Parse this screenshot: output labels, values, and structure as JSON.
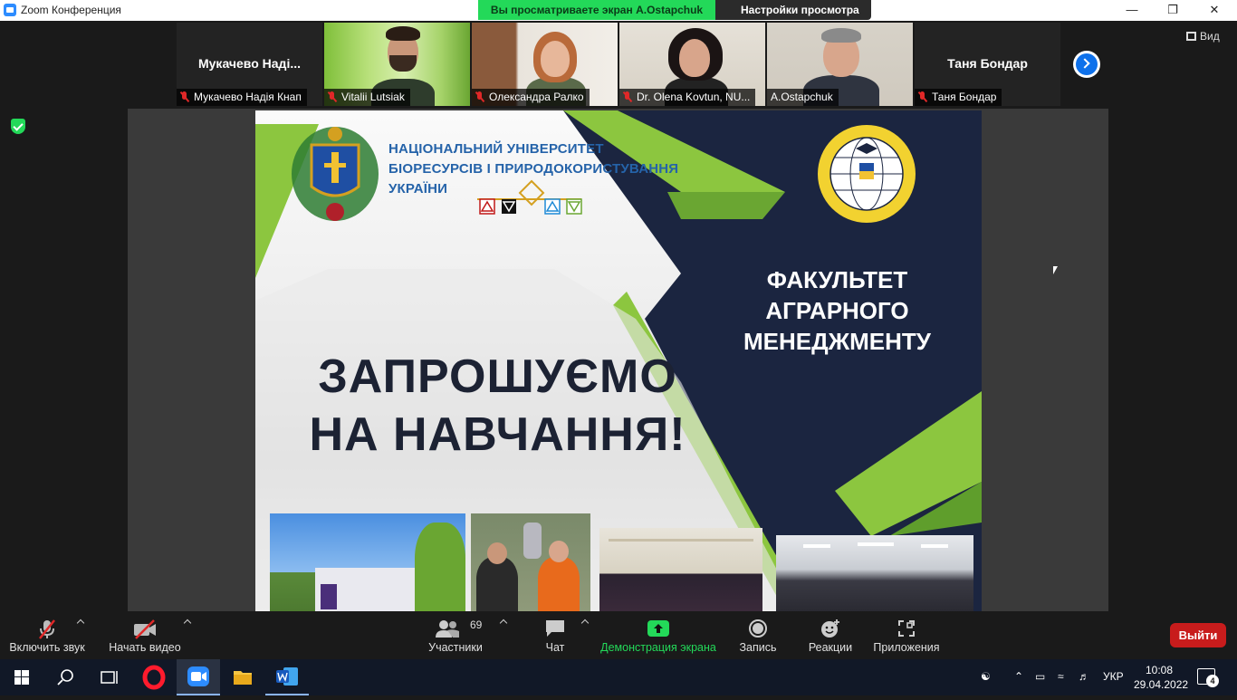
{
  "window": {
    "title": "Zoom Конференция",
    "minimize": "—",
    "maximize": "❐",
    "close": "✕"
  },
  "share": {
    "banner": "Вы просматриваете экран A.Ostapchuk",
    "view_settings": "Настройки просмотра"
  },
  "gallery": {
    "tiles": [
      {
        "big_name": "Мукачево  Наді...",
        "label": "Мукачево Надія Кнап",
        "muted": true,
        "video": false
      },
      {
        "label": "Vitalii Lutsiak",
        "muted": true,
        "video": true
      },
      {
        "label": "Олександра Ралко",
        "muted": true,
        "video": true
      },
      {
        "label": "Dr. Olena Kovtun, NU...",
        "muted": true,
        "video": true
      },
      {
        "label": "A.Ostapchuk",
        "muted": false,
        "video": true,
        "active": true
      },
      {
        "big_name": "Таня Бондар",
        "label": "Таня Бондар",
        "muted": true,
        "video": false
      }
    ],
    "view_label": "Вид"
  },
  "slide": {
    "university": [
      "НАЦІОНАЛЬНИЙ УНІВЕРСИТЕТ",
      "БІОРЕСУРСІВ І ПРИРОДОКОРИСТУВАННЯ",
      "УКРАЇНИ"
    ],
    "faculty": [
      "ФАКУЛЬТЕТ",
      "АГРАРНОГО",
      "МЕНЕДЖМЕНТУ"
    ],
    "invite": [
      "ЗАПРОШУЄМО",
      "НА НАВЧАННЯ!"
    ],
    "logo_text": "НУБіП",
    "seal_text": "ФАКУЛЬТЕТ АГРАРНОГО МЕНЕДЖМЕНТУ НУБіП УКРАЇНИ"
  },
  "toolbar": {
    "audio": "Включить звук",
    "video": "Начать видео",
    "participants": "Участники",
    "participants_count": "69",
    "chat": "Чат",
    "share": "Демонстрация экрана",
    "record": "Запись",
    "reactions": "Реакции",
    "apps": "Приложения",
    "leave": "Выйти"
  },
  "taskbar": {
    "language": "УКР",
    "time": "10:08",
    "date": "29.04.2022",
    "notifications": "4"
  },
  "colors": {
    "accent": "#0e71eb",
    "share_green": "#23d959",
    "leave_red": "#c81c1c",
    "slide_navy": "#1b2540",
    "slide_green": "#8cc63f"
  }
}
